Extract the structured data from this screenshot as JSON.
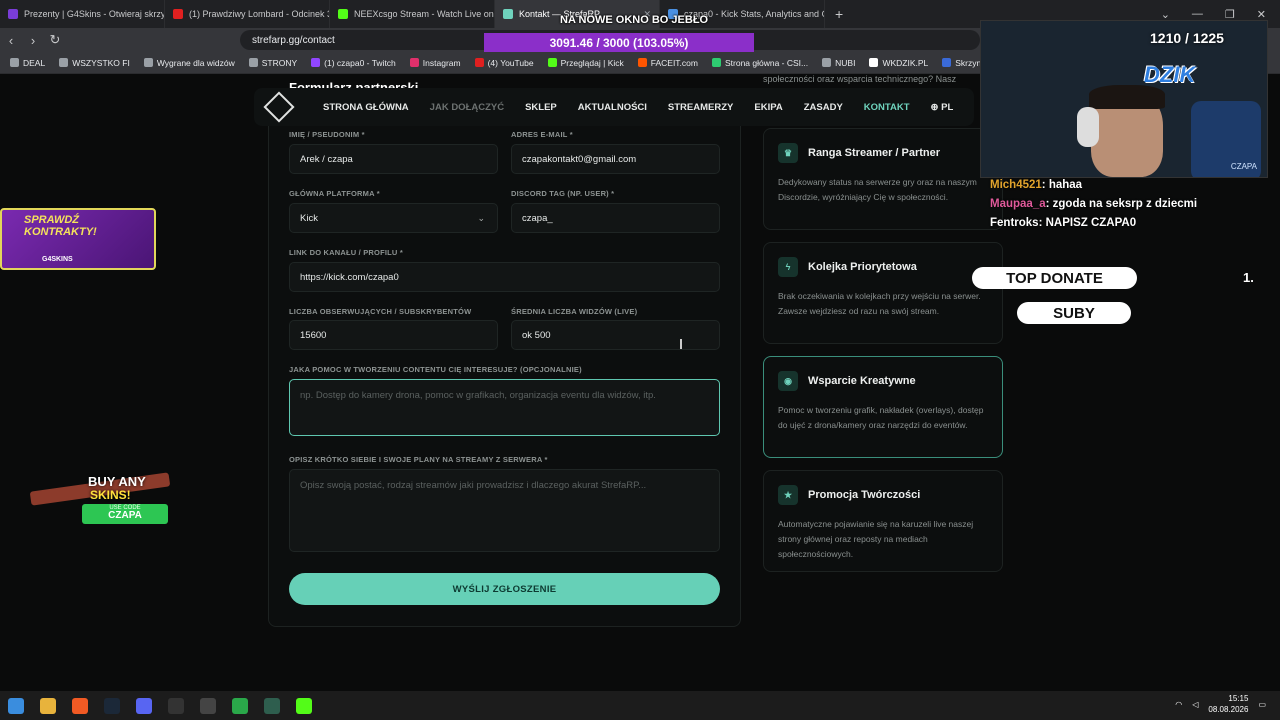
{
  "browser": {
    "tabs": [
      {
        "label": "Prezenty | G4Skins - Otwieraj skrzynki",
        "color": "#7a3dd8",
        "active": false
      },
      {
        "label": "(1) Prawdziwy Lombard - Odcinek 37",
        "color": "#e02020",
        "active": false
      },
      {
        "label": "NEEXcsgo Stream - Watch Live on Kick",
        "color": "#53fc18",
        "active": false
      },
      {
        "label": "Kontakt — StrefaRP",
        "color": "#6fd3bd",
        "active": true
      },
      {
        "label": "czapa0 - Kick Stats, Analytics and Ch",
        "color": "#4a90e2",
        "active": false
      }
    ],
    "url": "strefarp.gg/contact",
    "bookmarks": [
      "DEAL",
      "WSZYSTKO FI",
      "Wygrane dla widzów",
      "STRONY",
      "(1) czapa0 - Twitch",
      "Instagram",
      "(4) YouTube",
      "Przeglądaj | Kick",
      "FACEIT.com",
      "Strona główna - CSI...",
      "NUBI",
      "WKDZIK.PL",
      "Skrzynki CS:GO/CS..."
    ]
  },
  "overlay": {
    "window_title": "NA NOWE OKNO BO JEBŁO",
    "donation_bar": "3091.46 / 3000 (103.05%)",
    "sub_goal_current": "1210",
    "sub_goal_target": "/ 1225",
    "brand": "DZIK",
    "webcam_label": "CZAPA",
    "promo_top": {
      "title": "SPRAWDŹ KONTRAKTY!",
      "brand": "G4SKINS"
    },
    "promo_bottom": {
      "line1": "BUY ANY",
      "line2": "SKINS!",
      "use_code": "USE CODE",
      "code": "CZAPA"
    },
    "chat": [
      {
        "user": "Mich4521",
        "msg": "hahaa",
        "color": "#e0a32d"
      },
      {
        "user": "Maupaa_a",
        "msg": "zgoda na seksrp z dziecmi",
        "color": "#e05a9b"
      },
      {
        "user": "Fentroks",
        "msg": "NAPISZ CZAPA0",
        "color": "#ffffff"
      }
    ],
    "top_donate": "TOP DONATE",
    "top_donate_num": "1.",
    "suby": "SUBY"
  },
  "site": {
    "nav": [
      "STRONA GŁÓWNA",
      "JAK DOŁĄCZYĆ",
      "SKLEP",
      "AKTUALNOŚCI",
      "STREAMERZY",
      "EKIPA",
      "ZASADY",
      "KONTAKT",
      "PL"
    ],
    "form_title": "Formularz partnerski",
    "top_snippet": "społeczności oraz wsparcia technicznego? Nasz",
    "fields": {
      "nick_label": "IMIĘ / PSEUDONIM *",
      "nick_value": "Arek / czapa",
      "email_label": "ADRES E-MAIL *",
      "email_value": "czapakontakt0@gmail.com",
      "platform_label": "GŁÓWNA PLATFORMA *",
      "platform_value": "Kick",
      "discord_label": "DISCORD TAG (NP. USER) *",
      "discord_value": "czapa_",
      "link_label": "LINK DO KANAŁU / PROFILU *",
      "link_value": "https://kick.com/czapa0",
      "followers_label": "LICZBA OBSERWUJĄCYCH / SUBSKRYBENTÓW",
      "followers_value": "15600",
      "avg_label": "ŚREDNIA LICZBA WIDZÓW (LIVE)",
      "avg_value": "ok 500",
      "help_label": "JAKA POMOC W TWORZENIU CONTENTU CIĘ INTERESUJE? (OPCJONALNIE)",
      "help_placeholder": "np. Dostęp do kamery drona, pomoc w grafikach, organizacja eventu dla widzów, itp.",
      "plans_label": "OPISZ KRÓTKO SIEBIE I SWOJE PLANY NA STREAMY Z SERWERA *",
      "plans_placeholder": "Opisz swoją postać, rodzaj streamów jaki prowadzisz i dlaczego akurat StrefaRP..."
    },
    "submit": "WYŚLIJ ZGŁOSZENIE",
    "benefits": [
      {
        "title": "Ranga Streamer / Partner",
        "desc": "Dedykowany status na serwerze gry oraz na naszym Discordzie, wyróżniający Cię w społeczności.",
        "icon": "trophy-icon",
        "glyph": "♛"
      },
      {
        "title": "Kolejka Priorytetowa",
        "desc": "Brak oczekiwania w kolejkach przy wejściu na serwer. Zawsze wejdziesz od razu na swój stream.",
        "icon": "bolt-icon",
        "glyph": "ϟ"
      },
      {
        "title": "Wsparcie Kreatywne",
        "desc": "Pomoc w tworzeniu grafik, nakładek (overlays), dostęp do ujęć z drona/kamery oraz narzędzi do eventów.",
        "icon": "camera-icon",
        "glyph": "◉"
      },
      {
        "title": "Promocja Twórczości",
        "desc": "Automatyczne pojawianie się na karuzeli live naszej strony głównej oraz reposty na mediach społecznościowych.",
        "icon": "star-icon",
        "glyph": "★"
      }
    ]
  },
  "taskbar": {
    "time": "15:15",
    "date": "08.08.2026"
  }
}
